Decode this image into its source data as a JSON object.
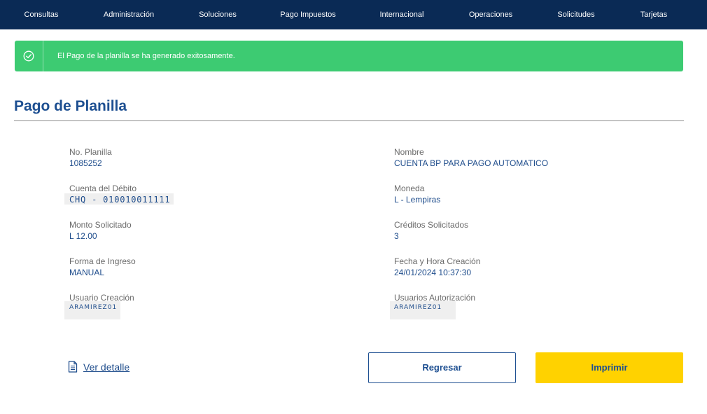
{
  "nav": {
    "items": [
      {
        "label": "Consultas"
      },
      {
        "label": "Administración"
      },
      {
        "label": "Soluciones"
      },
      {
        "label": "Pago Impuestos"
      },
      {
        "label": "Internacional"
      },
      {
        "label": "Operaciones"
      },
      {
        "label": "Solicitudes"
      },
      {
        "label": "Tarjetas"
      }
    ]
  },
  "alert": {
    "icon": "check-circle-icon",
    "message": "El Pago de la planilla se ha generado exitosamente."
  },
  "page": {
    "title": "Pago de Planilla"
  },
  "details": {
    "planilla": {
      "label": "No. Planilla",
      "value": "1085252"
    },
    "nombre": {
      "label": "Nombre",
      "value": "CUENTA BP PARA PAGO AUTOMATICO"
    },
    "cuenta": {
      "label": "Cuenta del Débito",
      "value": "CHQ - 010010011111"
    },
    "moneda": {
      "label": "Moneda",
      "value": "L - Lempiras"
    },
    "monto": {
      "label": "Monto Solicitado",
      "value": "L 12.00"
    },
    "creditos": {
      "label": "Créditos Solicitados",
      "value": "3"
    },
    "forma": {
      "label": "Forma de Ingreso",
      "value": "MANUAL"
    },
    "fecha": {
      "label": "Fecha y Hora Creación",
      "value": "24/01/2024 10:37:30"
    },
    "usuario_creacion": {
      "label": "Usuario Creación",
      "value": "ARAMIREZ01"
    },
    "usuarios_autorizacion": {
      "label": "Usuarios Autorización",
      "value": "ARAMIREZ01"
    }
  },
  "actions": {
    "detail_link": "Ver detalle",
    "detail_icon": "document-icon",
    "back_label": "Regresar",
    "print_label": "Imprimir"
  },
  "colors": {
    "nav_bg": "#0a2a55",
    "success": "#3dcb72",
    "brand_blue": "#1d4f91",
    "accent_yellow": "#ffd200"
  }
}
